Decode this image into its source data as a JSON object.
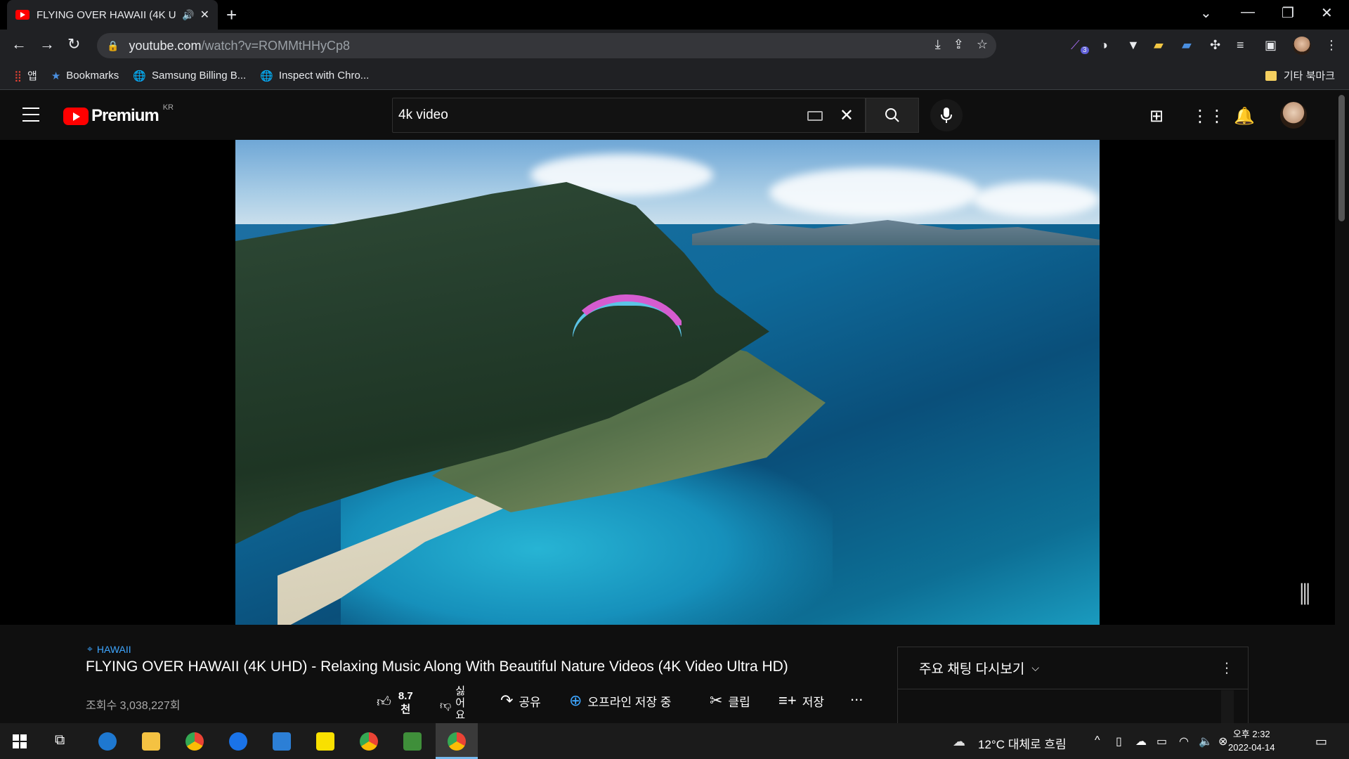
{
  "browser": {
    "tab_title": "FLYING OVER HAWAII (4K U",
    "url_host": "youtube.com",
    "url_path": "/watch?v=ROMMtHHyCp8",
    "bookmarks": [
      {
        "label": "앱"
      },
      {
        "label": "Bookmarks"
      },
      {
        "label": "Samsung Billing B..."
      },
      {
        "label": "Inspect with Chro..."
      }
    ],
    "other_bookmarks": "기타 북마크",
    "extension_badge": "3"
  },
  "youtube": {
    "logo_text": "Premium",
    "region": "KR",
    "search_value": "4k video",
    "video": {
      "hashtag": "HAWAII",
      "title": "FLYING OVER HAWAII (4K UHD) - Relaxing Music Along With Beautiful Nature Videos (4K Video Ultra HD)",
      "views": "조회수 3,038,227회",
      "likes_line1": "8.7",
      "likes_line2": "천",
      "dislike_label": "싫어요",
      "share_label": "공유",
      "offline_label": "오프라인 저장 중",
      "clip_label": "클립",
      "save_label": "저장",
      "more_label": "..."
    },
    "chat": {
      "header": "주요 채팅 다시보기"
    }
  },
  "taskbar": {
    "weather": "12°C 대체로 흐림",
    "time": "오후 2:32",
    "date": "2022-04-14"
  },
  "colors": {
    "youtube_red": "#ff0000",
    "link_blue": "#3ea6ff",
    "chrome_dark": "#202124"
  }
}
